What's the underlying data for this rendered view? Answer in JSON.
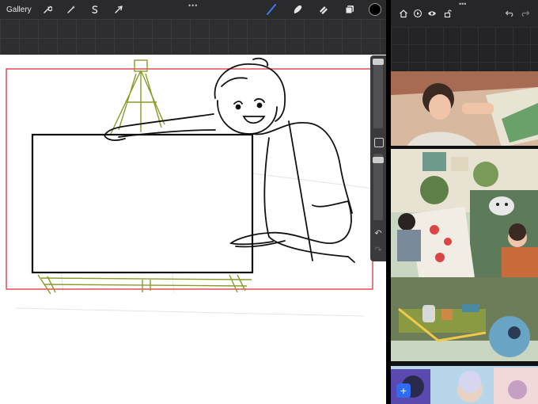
{
  "toolbar": {
    "gallery_label": "Gallery",
    "left_tools": [
      {
        "name": "wrench-icon"
      },
      {
        "name": "magic-wand-icon"
      },
      {
        "name": "selection-icon"
      },
      {
        "name": "transform-arrow-icon"
      }
    ],
    "more_dots": "•••",
    "right_tools": [
      {
        "name": "brush-icon",
        "active": true
      },
      {
        "name": "smudge-icon"
      },
      {
        "name": "eraser-icon"
      },
      {
        "name": "layers-icon"
      }
    ],
    "current_color": "#000000",
    "active_color": "#3d7bf5"
  },
  "sidebar": {
    "undo_symbol": "↶",
    "redo_symbol": "↷"
  },
  "reference_toolbar": {
    "more_dots": "•••",
    "icons": [
      "home-icon",
      "play-icon",
      "eye-icon",
      "lock-icon",
      "undo-icon",
      "redo-icon"
    ]
  },
  "add_button": {
    "label": "+"
  },
  "colors": {
    "sketch_green": "#8c9a2a",
    "frame_red": "#d9232b",
    "ink": "#111111",
    "accent_blue": "#2f6cf5"
  }
}
